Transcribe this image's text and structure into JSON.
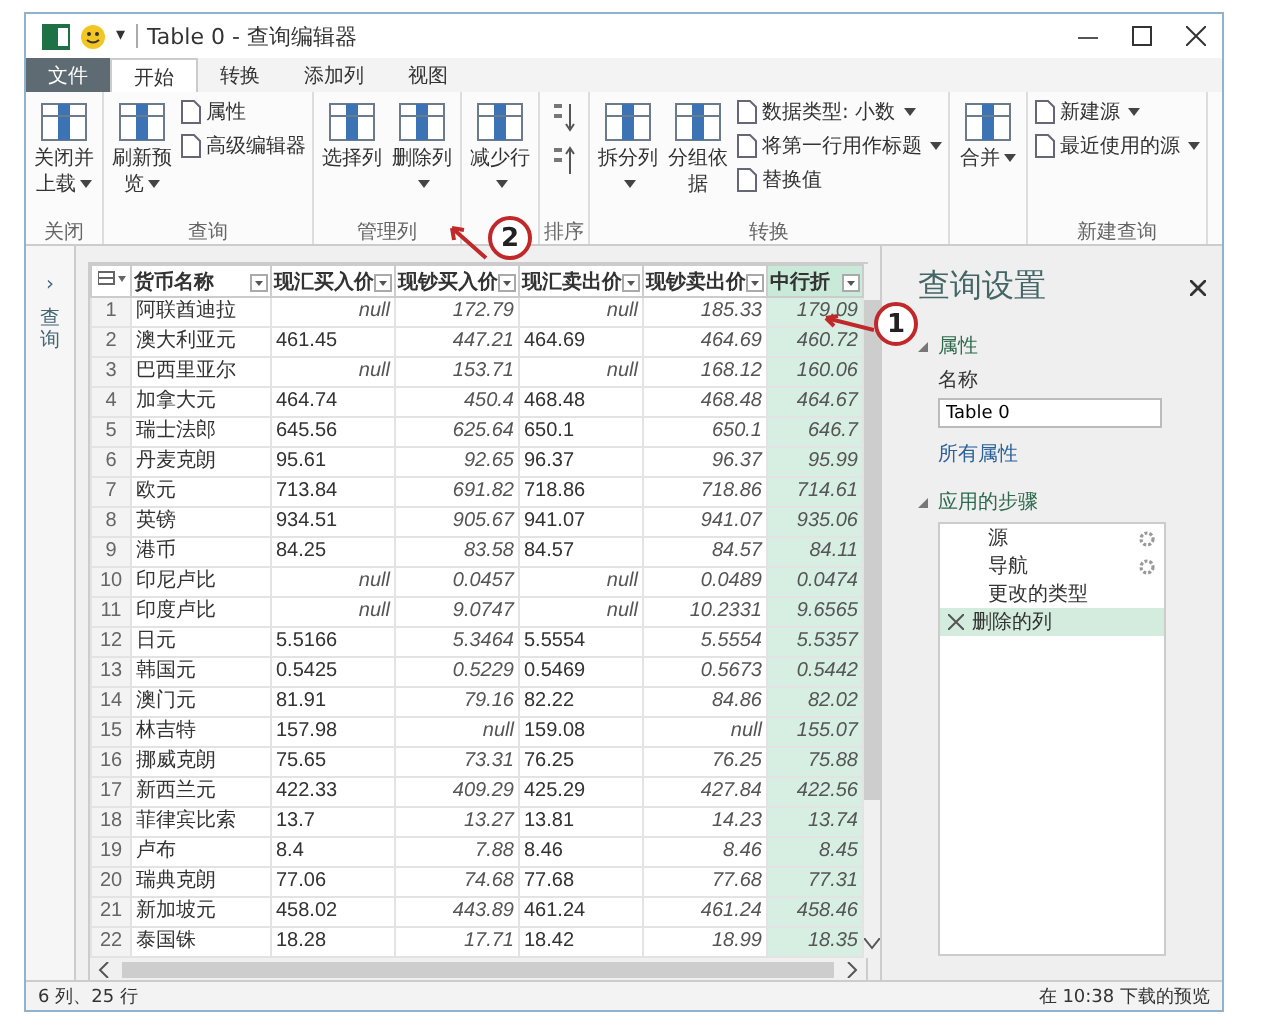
{
  "window": {
    "title": "Table 0 - 查询编辑器",
    "quick_access_caret": "▾"
  },
  "tabs": [
    {
      "label": "文件",
      "kind": "file",
      "selected": false
    },
    {
      "label": "开始",
      "kind": "tab",
      "selected": true
    },
    {
      "label": "转换",
      "kind": "tab",
      "selected": false
    },
    {
      "label": "添加列",
      "kind": "tab",
      "selected": false
    },
    {
      "label": "视图",
      "kind": "tab",
      "selected": false
    }
  ],
  "ribbon": [
    {
      "label": "关闭",
      "kind": "buttons",
      "items": [
        {
          "kind": "large",
          "label": "关闭并上载",
          "menu": true
        }
      ]
    },
    {
      "label": "查询",
      "kind": "buttons",
      "items": [
        {
          "kind": "large",
          "label": "刷新预览",
          "menu": true
        },
        {
          "kind": "small",
          "label": "属性",
          "menu": false
        },
        {
          "kind": "small",
          "label": "高级编辑器",
          "menu": false
        }
      ]
    },
    {
      "label": "管理列",
      "kind": "buttons",
      "items": [
        {
          "kind": "large",
          "label": "选择列",
          "menu": false
        },
        {
          "kind": "large",
          "label": "删除列",
          "menu": true
        }
      ]
    },
    {
      "kind": "buttons",
      "items": [
        {
          "kind": "large",
          "label": "减少行",
          "menu": true
        }
      ]
    },
    {
      "label": "排序",
      "kind": "sort"
    },
    {
      "label": "转换",
      "kind": "buttons",
      "items": [
        {
          "kind": "large",
          "label": "拆分列",
          "menu": true
        },
        {
          "kind": "large",
          "label": "分组依据",
          "menu": false
        },
        {
          "kind": "small",
          "label": "数据类型: 小数",
          "menu": true
        },
        {
          "kind": "small",
          "label": "将第一行用作标题",
          "menu": true
        },
        {
          "kind": "small",
          "label": "替换值",
          "menu": false
        }
      ]
    },
    {
      "kind": "buttons",
      "items": [
        {
          "kind": "large",
          "label": "合并",
          "menu": true
        }
      ]
    },
    {
      "label": "新建查询",
      "kind": "buttons",
      "items": [
        {
          "kind": "small",
          "label": "新建源",
          "menu": true
        },
        {
          "kind": "small",
          "label": "最近使用的源",
          "menu": true
        }
      ]
    }
  ],
  "queries_pane": {
    "label": "查询",
    "expand_glyph": "›"
  },
  "table": {
    "columns": [
      {
        "label": "货币名称",
        "kind": "text",
        "selected": false
      },
      {
        "label": "现汇买入价",
        "kind": "text",
        "selected": false
      },
      {
        "label": "现钞买入价",
        "kind": "number",
        "selected": false
      },
      {
        "label": "现汇卖出价",
        "kind": "text",
        "selected": false
      },
      {
        "label": "现钞卖出价",
        "kind": "number",
        "selected": false
      },
      {
        "label": "中行折",
        "kind": "number",
        "selected": true
      }
    ],
    "rows": [
      {
        "n": "1",
        "cells": [
          "阿联酋迪拉",
          {
            "text": "null",
            "kind": "null"
          },
          "172.79",
          {
            "text": "null",
            "kind": "null"
          },
          "185.33",
          "179.09"
        ]
      },
      {
        "n": "2",
        "cells": [
          "澳大利亚元",
          "461.45",
          "447.21",
          "464.69",
          "464.69",
          "460.72"
        ]
      },
      {
        "n": "3",
        "cells": [
          "巴西里亚尔",
          {
            "text": "null",
            "kind": "null"
          },
          "153.71",
          {
            "text": "null",
            "kind": "null"
          },
          "168.12",
          "160.06"
        ]
      },
      {
        "n": "4",
        "cells": [
          "加拿大元",
          "464.74",
          "450.4",
          "468.48",
          "468.48",
          "464.67"
        ]
      },
      {
        "n": "5",
        "cells": [
          "瑞士法郎",
          "645.56",
          "625.64",
          "650.1",
          "650.1",
          "646.7"
        ]
      },
      {
        "n": "6",
        "cells": [
          "丹麦克朗",
          "95.61",
          "92.65",
          "96.37",
          "96.37",
          "95.99"
        ]
      },
      {
        "n": "7",
        "cells": [
          "欧元",
          "713.84",
          "691.82",
          "718.86",
          "718.86",
          "714.61"
        ]
      },
      {
        "n": "8",
        "cells": [
          "英镑",
          "934.51",
          "905.67",
          "941.07",
          "941.07",
          "935.06"
        ]
      },
      {
        "n": "9",
        "cells": [
          "港币",
          "84.25",
          "83.58",
          "84.57",
          "84.57",
          "84.11"
        ]
      },
      {
        "n": "10",
        "cells": [
          "印尼卢比",
          {
            "text": "null",
            "kind": "null"
          },
          "0.0457",
          {
            "text": "null",
            "kind": "null"
          },
          "0.0489",
          "0.0474"
        ]
      },
      {
        "n": "11",
        "cells": [
          "印度卢比",
          {
            "text": "null",
            "kind": "null"
          },
          "9.0747",
          {
            "text": "null",
            "kind": "null"
          },
          "10.2331",
          "9.6565"
        ]
      },
      {
        "n": "12",
        "cells": [
          "日元",
          "5.5166",
          "5.3464",
          "5.5554",
          "5.5554",
          "5.5357"
        ]
      },
      {
        "n": "13",
        "cells": [
          "韩国元",
          "0.5425",
          "0.5229",
          "0.5469",
          "0.5673",
          "0.5442"
        ]
      },
      {
        "n": "14",
        "cells": [
          "澳门元",
          "81.91",
          "79.16",
          "82.22",
          "84.86",
          "82.02"
        ]
      },
      {
        "n": "15",
        "cells": [
          "林吉特",
          "157.98",
          "null",
          "159.08",
          "null",
          "155.07"
        ]
      },
      {
        "n": "16",
        "cells": [
          "挪威克朗",
          "75.65",
          "73.31",
          "76.25",
          "76.25",
          "75.88"
        ]
      },
      {
        "n": "17",
        "cells": [
          "新西兰元",
          "422.33",
          "409.29",
          "425.29",
          "427.84",
          "422.56"
        ]
      },
      {
        "n": "18",
        "cells": [
          "菲律宾比索",
          "13.7",
          "13.27",
          "13.81",
          "14.23",
          "13.74"
        ]
      },
      {
        "n": "19",
        "cells": [
          "卢布",
          "8.4",
          "7.88",
          "8.46",
          "8.46",
          "8.45"
        ]
      },
      {
        "n": "20",
        "cells": [
          "瑞典克朗",
          "77.06",
          "74.68",
          "77.68",
          "77.68",
          "77.31"
        ]
      },
      {
        "n": "21",
        "cells": [
          "新加坡元",
          "458.02",
          "443.89",
          "461.24",
          "461.24",
          "458.46"
        ]
      },
      {
        "n": "22",
        "cells": [
          "泰国铢",
          "18.28",
          "17.71",
          "18.42",
          "18.99",
          "18.35"
        ]
      }
    ]
  },
  "settings": {
    "title": "查询设置",
    "properties_heading": "属性",
    "name_label": "名称",
    "name_value": "Table 0",
    "all_properties_link": "所有属性",
    "steps_heading": "应用的步骤",
    "steps": [
      {
        "label": "源",
        "gear": true,
        "selected": false
      },
      {
        "label": "导航",
        "gear": true,
        "selected": false
      },
      {
        "label": "更改的类型",
        "gear": false,
        "selected": false
      },
      {
        "label": "删除的列",
        "gear": false,
        "selected": true
      }
    ]
  },
  "status_bar": {
    "left": "6 列、25 行",
    "right": "在 10:38 下载的预览"
  },
  "annotations": [
    {
      "label": "1"
    },
    {
      "label": "2"
    }
  ]
}
